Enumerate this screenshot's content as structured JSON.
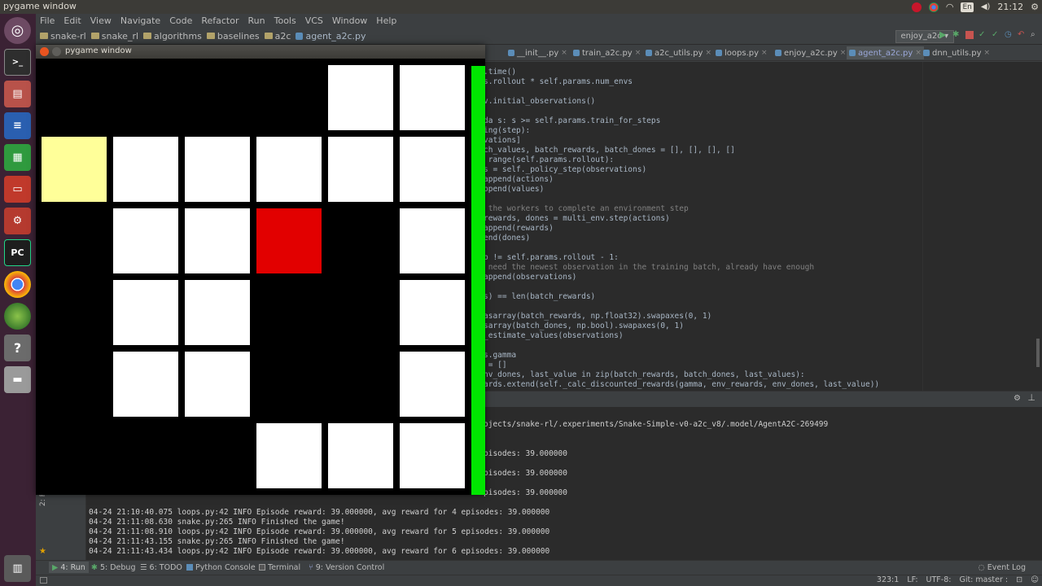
{
  "top_panel": {
    "window_title": "pygame window",
    "lang": "En",
    "clock": "21:12"
  },
  "ide": {
    "menu": [
      "File",
      "Edit",
      "View",
      "Navigate",
      "Code",
      "Refactor",
      "Run",
      "Tools",
      "VCS",
      "Window",
      "Help"
    ],
    "breadcrumbs": [
      "snake-rl",
      "snake_rl",
      "algorithms",
      "baselines",
      "a2c"
    ],
    "breadcrumb_file": "agent_a2c.py",
    "run_config": "enjoy_a2c",
    "tabs": [
      "__init__.py",
      "train_a2c.py",
      "a2c_utils.py",
      "loops.py",
      "enjoy_a2c.py",
      "agent_a2c.py",
      "dnn_utils.py"
    ],
    "active_tab": "agent_a2c.py",
    "code_lines": [
      {
        "text": ".time()",
        "style": "code"
      },
      {
        "text": "s.rollout * self.params.num_envs",
        "style": "code"
      },
      {
        "text": "",
        "style": "code"
      },
      {
        "text": "v.initial_observations()",
        "style": "code"
      },
      {
        "text": "",
        "style": "code"
      },
      {
        "text": "da s: s >= self.params.train_for_steps",
        "style": "code"
      },
      {
        "text": "ing(step):",
        "style": "code"
      },
      {
        "text": "vations]",
        "style": "code"
      },
      {
        "text": "ch_values, batch_rewards, batch_dones = [], [], [], []",
        "style": "code"
      },
      {
        "text": " range(self.params.rollout):",
        "style": "code"
      },
      {
        "text": "s = self._policy_step(observations)",
        "style": "code"
      },
      {
        "text": "append(actions)",
        "style": "code"
      },
      {
        "text": "ppend(values)",
        "style": "code"
      },
      {
        "text": "",
        "style": "code"
      },
      {
        "text": " the workers to complete an environment step",
        "style": "comment"
      },
      {
        "text": "rewards, dones = multi_env.step(actions)",
        "style": "code"
      },
      {
        "text": "append(rewards)",
        "style": "code"
      },
      {
        "text": "end(dones)",
        "style": "code"
      },
      {
        "text": "",
        "style": "code"
      },
      {
        "text": "p != self.params.rollout - 1:",
        "style": "code"
      },
      {
        "text": " need the newest observation in the training batch, already have enough",
        "style": "comment"
      },
      {
        "text": "append(observations)",
        "style": "code"
      },
      {
        "text": "",
        "style": "code"
      },
      {
        "text": "s) == len(batch_rewards)",
        "style": "code"
      },
      {
        "text": "",
        "style": "code"
      },
      {
        "text": "asarray(batch_rewards, np.float32).swapaxes(0, 1)",
        "style": "code"
      },
      {
        "text": "sarray(batch_dones, np.bool).swapaxes(0, 1)",
        "style": "code"
      },
      {
        "text": "_estimate_values(observations)",
        "style": "code"
      },
      {
        "text": "",
        "style": "code"
      },
      {
        "text": "s.gamma",
        "style": "code"
      },
      {
        "text": " = []",
        "style": "code"
      },
      {
        "text": "nv_dones, last_value in zip(batch_rewards, batch_dones, last_values):",
        "style": "code"
      },
      {
        "text": "ards.extend(self._calc_discounted_rewards(gamma, env_rewards, env_dones, last_value))",
        "style": "code"
      }
    ],
    "console_partial": [
      "ojects/snake-rl/.experiments/Snake-Simple-v0-a2c_v8/.model/AgentA2C-269499",
      "",
      "",
      "pisodes: 39.000000",
      "",
      "pisodes: 39.000000",
      "",
      "pisodes: 39.000000"
    ],
    "console_full": [
      "04-24 21:10:40.075 loops.py:42 INFO Episode reward: 39.000000, avg reward for 4 episodes: 39.000000",
      "04-24 21:11:08.630 snake.py:265 INFO Finished the game!",
      "04-24 21:11:08.910 loops.py:42 INFO Episode reward: 39.000000, avg reward for 5 episodes: 39.000000",
      "04-24 21:11:43.155 snake.py:265 INFO Finished the game!",
      "04-24 21:11:43.434 loops.py:42 INFO Episode reward: 39.000000, avg reward for 6 episodes: 39.000000"
    ],
    "favorites_label": "2: Favorites",
    "tool_windows": [
      "4: Run",
      "5: Debug",
      "6: TODO",
      "Python Console",
      "Terminal",
      "9: Version Control"
    ],
    "event_log": "Event Log",
    "status": {
      "position": "323:1",
      "line_sep": "LF:",
      "encoding": "UTF-8:",
      "git": "Git: master :"
    }
  },
  "pygame": {
    "title": "pygame window",
    "board": {
      "grid_cols": 6,
      "grid_rows": 6,
      "body_cells": [
        [
          4,
          0
        ],
        [
          5,
          0
        ],
        [
          1,
          1
        ],
        [
          2,
          1
        ],
        [
          3,
          1
        ],
        [
          4,
          1
        ],
        [
          5,
          1
        ],
        [
          1,
          2
        ],
        [
          2,
          2
        ],
        [
          5,
          2
        ],
        [
          1,
          3
        ],
        [
          2,
          3
        ],
        [
          5,
          3
        ],
        [
          1,
          4
        ],
        [
          2,
          4
        ],
        [
          5,
          4
        ],
        [
          3,
          5
        ],
        [
          4,
          5
        ],
        [
          5,
          5
        ]
      ],
      "head_cell": [
        0,
        1
      ],
      "apple_cell": [
        3,
        2
      ],
      "colors": {
        "body": "#ffffff",
        "head": "#ffff99",
        "apple": "#e20000",
        "background": "#000000",
        "bar": "#00e600"
      }
    }
  },
  "colors": {
    "launcher_bg": "#3b2234",
    "ide_bg": "#3c3f41",
    "editor_bg": "#2b2b2b"
  }
}
